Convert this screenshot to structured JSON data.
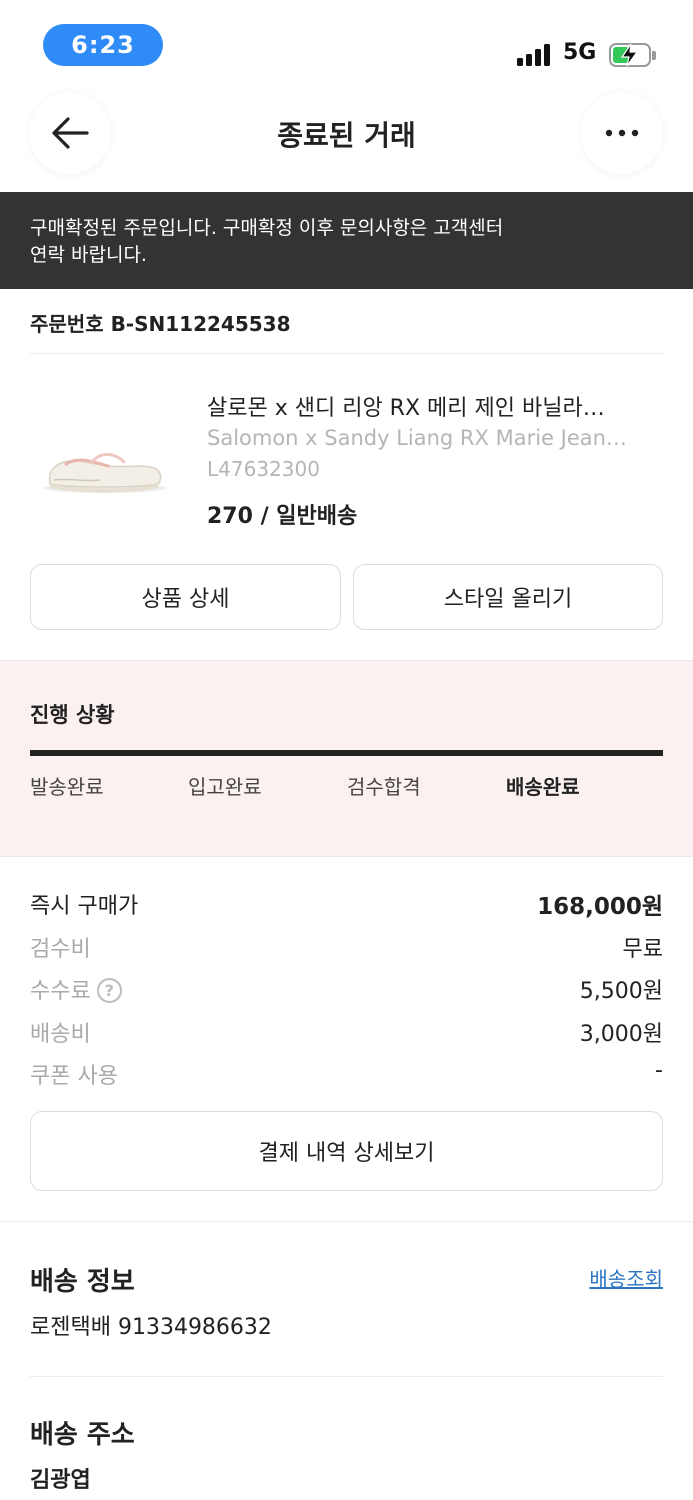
{
  "status_bar": {
    "time": "6:23",
    "network": "5G",
    "icons": [
      "signal-icon",
      "battery-charging-icon"
    ]
  },
  "header": {
    "title": "종료된 거래",
    "back_icon": "arrow-left-icon",
    "more_icon": "more-horizontal-icon"
  },
  "notice": {
    "line1": "구매확정된 주문입니다. 구매확정 이후 문의사항은 고객센터",
    "line2": "연락 바랍니다."
  },
  "order": {
    "number_label": "주문번호 B-SN112245538"
  },
  "product": {
    "name_ko": "살로몬 x 샌디 리앙 RX 메리 제인 바닐라…",
    "name_en": "Salomon x Sandy Liang RX Marie Jean…",
    "code": "L47632300",
    "size_delivery": "270 / 일반배송",
    "image_icon": "sneaker-image"
  },
  "actions": {
    "detail": "상품 상세",
    "style": "스타일 올리기"
  },
  "progress": {
    "title": "진행 상황",
    "steps": [
      "발송완료",
      "입고완료",
      "검수합격",
      "배송완료"
    ],
    "current_step_index": 3,
    "completion": 1.0
  },
  "price": {
    "instant_label": "즉시 구매가",
    "instant_value": "168,000원",
    "inspection_label": "검수비",
    "inspection_value": "무료",
    "fee_label": "수수료",
    "fee_help": "?",
    "fee_value": "5,500원",
    "shipping_label": "배송비",
    "shipping_value": "3,000원",
    "coupon_label": "쿠폰 사용",
    "coupon_value": "-"
  },
  "payment_button": "결제 내역 상세보기",
  "delivery": {
    "title": "배송 정보",
    "track_link": "배송조회",
    "tracking": "로젠택배 91334986632"
  },
  "address": {
    "title": "배송 주소",
    "recipient": "김광엽"
  },
  "colors": {
    "notice_bg": "#333333",
    "progress_bg": "#fcf1f1",
    "link": "#2d77c2",
    "time_pill": "#2f8bf5"
  }
}
